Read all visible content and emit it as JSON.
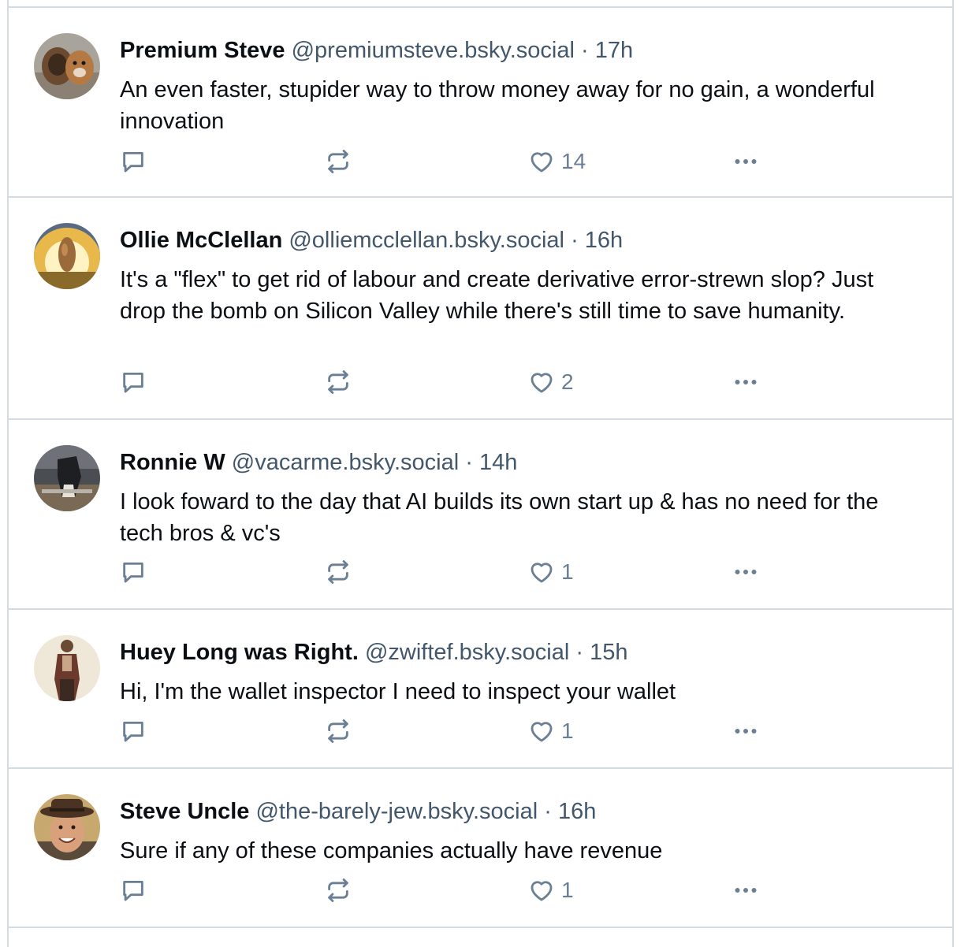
{
  "posts": [
    {
      "name": "Premium Steve",
      "handle": "@premiumsteve.bsky.social",
      "dot": "·",
      "time": "17h",
      "text": "An even faster, stupider way to throw money away for no gain, a wonderful innovation",
      "likes": "14",
      "avatar_icon": "dog-photo-avatar"
    },
    {
      "name": "Ollie McClellan",
      "handle": "@olliemcclellan.bsky.social",
      "dot": "·",
      "time": "16h",
      "text": "It's a \"flex\" to get rid of labour and create derivative error-strewn slop? Just drop the bomb on Silicon Valley while there's still time to save humanity.",
      "likes": "2",
      "avatar_icon": "glowing-potato-avatar"
    },
    {
      "name": "Ronnie W",
      "handle": "@vacarme.bsky.social",
      "dot": "·",
      "time": "14h",
      "text": "I look foward to the day that AI builds its own start up & has no need for the tech bros & vc's",
      "likes": "1",
      "avatar_icon": "horse-photo-avatar"
    },
    {
      "name": "Huey Long was Right.",
      "handle": "@zwiftef.bsky.social",
      "dot": "·",
      "time": "15h",
      "text": "Hi, I'm the wallet inspector I need to inspect your wallet",
      "likes": "1",
      "avatar_icon": "standing-man-avatar"
    },
    {
      "name": "Steve Uncle",
      "handle": "@the-barely-jew.bsky.social",
      "dot": "·",
      "time": "16h",
      "text": "Sure if any of these companies actually have revenue",
      "likes": "1",
      "avatar_icon": "man-in-hat-avatar"
    }
  ],
  "colors": {
    "border": "#d4dbe2",
    "muted_text": "#42576c",
    "icon": "#6b7f94",
    "text": "#0b0f14"
  }
}
